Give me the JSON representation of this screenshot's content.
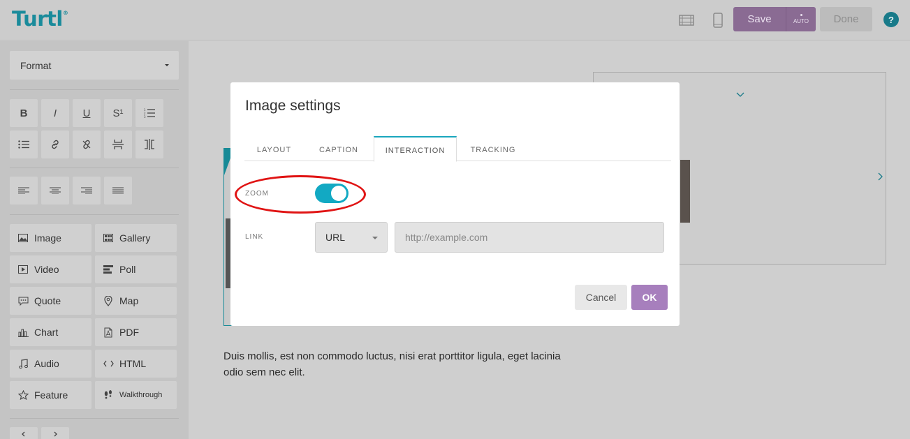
{
  "app": {
    "logo": "Turtl",
    "logo_mark": "®"
  },
  "toolbar": {
    "save_label": "Save",
    "auto_label": "AUTO",
    "done_label": "Done",
    "help_label": "?"
  },
  "sidebar": {
    "format_label": "Format",
    "format_buttons": [
      "B",
      "I",
      "U",
      "S¹"
    ],
    "blocks": [
      {
        "label": "Image",
        "icon": "image-icon"
      },
      {
        "label": "Gallery",
        "icon": "gallery-icon"
      },
      {
        "label": "Video",
        "icon": "video-icon"
      },
      {
        "label": "Poll",
        "icon": "poll-icon"
      },
      {
        "label": "Quote",
        "icon": "quote-icon"
      },
      {
        "label": "Map",
        "icon": "map-pin-icon"
      },
      {
        "label": "Chart",
        "icon": "chart-icon"
      },
      {
        "label": "PDF",
        "icon": "pdf-icon"
      },
      {
        "label": "Audio",
        "icon": "audio-icon"
      },
      {
        "label": "HTML",
        "icon": "code-icon"
      },
      {
        "label": "Feature",
        "icon": "star-icon"
      },
      {
        "label": "Walkthrough",
        "icon": "footsteps-icon"
      }
    ]
  },
  "canvas": {
    "paragraph": "Duis mollis, est non commodo luctus, nisi erat porttitor ligula, eget lacinia",
    "paragraph_line2": "odio sem nec elit."
  },
  "modal": {
    "title": "Image settings",
    "tabs": [
      {
        "label": "LAYOUT",
        "active": false
      },
      {
        "label": "CAPTION",
        "active": false
      },
      {
        "label": "INTERACTION",
        "active": true
      },
      {
        "label": "TRACKING",
        "active": false
      }
    ],
    "zoom_label": "ZOOM",
    "zoom_enabled": true,
    "link_label": "LINK",
    "link_type": "URL",
    "link_placeholder": "http://example.com",
    "cancel_label": "Cancel",
    "ok_label": "OK"
  },
  "colors": {
    "brand": "#1a8b9b",
    "accent_purple": "#a77fbd",
    "toggle_on": "#12a9c3",
    "highlight": "#e01414"
  }
}
